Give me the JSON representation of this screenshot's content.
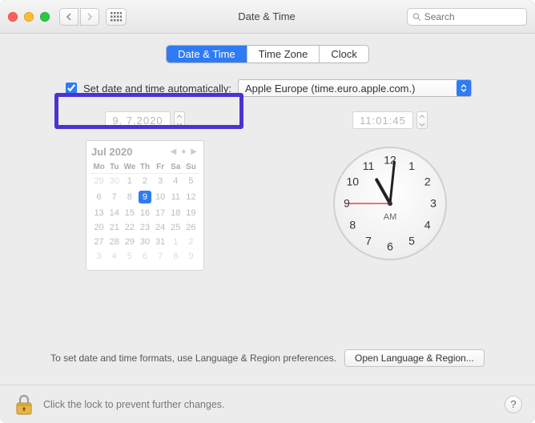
{
  "title": "Date & Time",
  "search_placeholder": "Search",
  "tabs": {
    "date_time": "Date & Time",
    "time_zone": "Time Zone",
    "clock": "Clock"
  },
  "auto": {
    "label": "Set date and time automatically:",
    "checked": true,
    "server": "Apple Europe (time.euro.apple.com.)"
  },
  "date_field": "9.  7.2020",
  "time_field": "11:01:45",
  "calendar": {
    "month_label": "Jul 2020",
    "dow": [
      "Mo",
      "Tu",
      "We",
      "Th",
      "Fr",
      "Sa",
      "Su"
    ],
    "selected": 9,
    "weeks": [
      [
        {
          "d": 29,
          "out": true
        },
        {
          "d": 30,
          "out": true
        },
        {
          "d": 1
        },
        {
          "d": 2
        },
        {
          "d": 3
        },
        {
          "d": 4
        },
        {
          "d": 5
        }
      ],
      [
        {
          "d": 6
        },
        {
          "d": 7
        },
        {
          "d": 8
        },
        {
          "d": 9,
          "sel": true
        },
        {
          "d": 10
        },
        {
          "d": 11
        },
        {
          "d": 12
        }
      ],
      [
        {
          "d": 13
        },
        {
          "d": 14
        },
        {
          "d": 15
        },
        {
          "d": 16
        },
        {
          "d": 17
        },
        {
          "d": 18
        },
        {
          "d": 19
        }
      ],
      [
        {
          "d": 20
        },
        {
          "d": 21
        },
        {
          "d": 22
        },
        {
          "d": 23
        },
        {
          "d": 24
        },
        {
          "d": 25
        },
        {
          "d": 26
        }
      ],
      [
        {
          "d": 27
        },
        {
          "d": 28
        },
        {
          "d": 29
        },
        {
          "d": 30
        },
        {
          "d": 31
        },
        {
          "d": 1,
          "out": true
        },
        {
          "d": 2,
          "out": true
        }
      ],
      [
        {
          "d": 3,
          "out": true
        },
        {
          "d": 4,
          "out": true
        },
        {
          "d": 5,
          "out": true
        },
        {
          "d": 6,
          "out": true
        },
        {
          "d": 7,
          "out": true
        },
        {
          "d": 8,
          "out": true
        },
        {
          "d": 9,
          "out": true
        }
      ]
    ]
  },
  "clock": {
    "hours": 11,
    "minutes": 1,
    "seconds": 45,
    "ampm": "AM"
  },
  "hint": "To set date and time formats, use Language & Region preferences.",
  "open_lang_btn": "Open Language & Region...",
  "lock_text": "Click the lock to prevent further changes.",
  "chart_data": null
}
